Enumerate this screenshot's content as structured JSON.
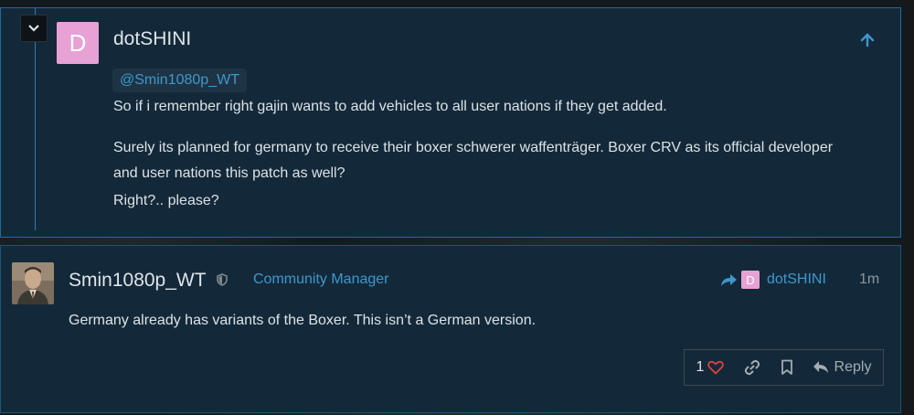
{
  "quoted_post": {
    "avatar_letter": "D",
    "username": "dotSHINI",
    "mention": "@Smin1080p_WT",
    "paragraphs": [
      "So if i remember right gajin wants to add vehicles to all user nations if they get added.",
      "Surely its planned for germany to receive their boxer schwerer waffenträger. Boxer CRV as its official developer",
      "and user nations this patch as well?",
      "Right?.. please?"
    ],
    "icons": {
      "collapse": "chevron-down-icon",
      "jump": "arrow-up-icon"
    }
  },
  "reply_post": {
    "username": "Smin1080p_WT",
    "role": "Community Manager",
    "reply_to_letter": "D",
    "reply_to_user": "dotSHINI",
    "timestamp": "1m",
    "body": "Germany already has variants of the Boxer. This isn’t a German version.",
    "actions": {
      "like_count": "1",
      "reply_label": "Reply"
    },
    "icons": {
      "moderator": "shield-icon",
      "reply_to": "share-arrow-icon",
      "like": "heart-icon",
      "link": "link-icon",
      "bookmark": "bookmark-icon",
      "reply": "reply-icon"
    }
  },
  "colors": {
    "card_bg": "#13293a",
    "accent": "#3f97cc",
    "avatar_pink": "#e7a1d5",
    "heart": "#e2403c",
    "text": "#dde2e5"
  }
}
